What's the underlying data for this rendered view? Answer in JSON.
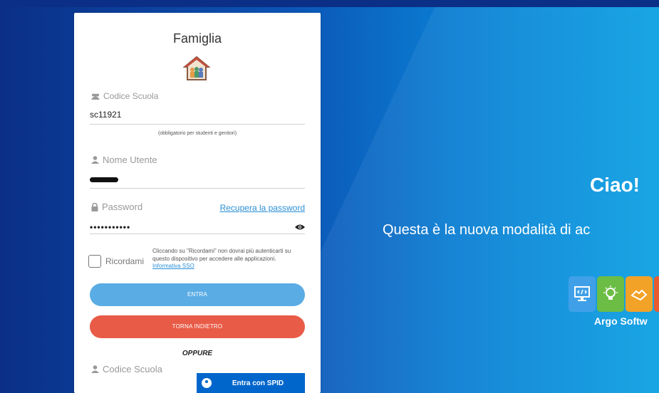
{
  "panel": {
    "title": "Famiglia",
    "codice_scuola_label": "Codice Scuola",
    "codice_scuola_value": "sc11921",
    "codice_hint": "(obbligatorio per studenti e genitori)",
    "nome_utente_label": "Nome Utente",
    "password_label": "Password",
    "recupera_link": "Recupera la password",
    "password_dots": "•••••••••••",
    "ricordami_label": "Ricordami",
    "ricordami_desc": "Cliccando su \"Ricordami\" non dovrai più autenticarti su questo dispositivo per accedere alle applicazioni.",
    "sso_link": "Informativa SSO",
    "entra_button": "ENTRA",
    "torna_button": "TORNA INDIETRO",
    "oppure": "OPPURE",
    "codice_scuola_label_2": "Codice Scuola",
    "spid_button": "Entra con SPID"
  },
  "right": {
    "greeting": "Ciao!",
    "subtitle": "Questa è la nuova modalità di ac",
    "brand": "Argo Softw"
  },
  "colors": {
    "primary_button": "#5aace4",
    "danger_button": "#e85b47",
    "spid_blue": "#0066cc",
    "link": "#2a8fd6"
  }
}
